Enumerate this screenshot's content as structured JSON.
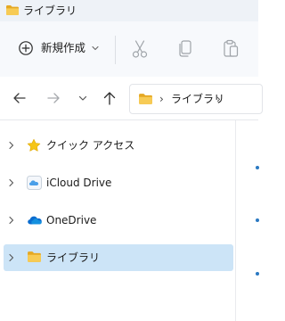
{
  "window": {
    "title": "ライブラリ",
    "title_icon": "folder-icon"
  },
  "commandbar": {
    "new_label": "新規作成",
    "new_icon": "plus-circle-icon",
    "new_chevron_icon": "chevron-down-icon",
    "actions": [
      {
        "name": "cut",
        "icon": "scissors-icon",
        "enabled": false
      },
      {
        "name": "copy",
        "icon": "copy-icon",
        "enabled": false
      },
      {
        "name": "paste",
        "icon": "clipboard-icon",
        "enabled": false
      }
    ]
  },
  "navigation": {
    "back_icon": "arrow-left-icon",
    "forward_icon": "arrow-right-icon",
    "recent_icon": "chevron-down-icon",
    "up_icon": "arrow-up-icon"
  },
  "address": {
    "segments": [
      "ライブラリ"
    ],
    "separator": "›",
    "icon": "folder-icon"
  },
  "tree": [
    {
      "label": "クイック アクセス",
      "icon": "star-icon",
      "selected": false
    },
    {
      "label": "iCloud Drive",
      "icon": "icloud-icon",
      "selected": false
    },
    {
      "label": "OneDrive",
      "icon": "onedrive-cloud-icon",
      "selected": false
    },
    {
      "label": "ライブラリ",
      "icon": "folder-icon",
      "selected": true
    }
  ],
  "colors": {
    "accent": "#0067c0",
    "selection": "#cce4f7",
    "folder": "#f2c94c",
    "star": "#f5c518",
    "onedrive": "#0a6ccf"
  }
}
